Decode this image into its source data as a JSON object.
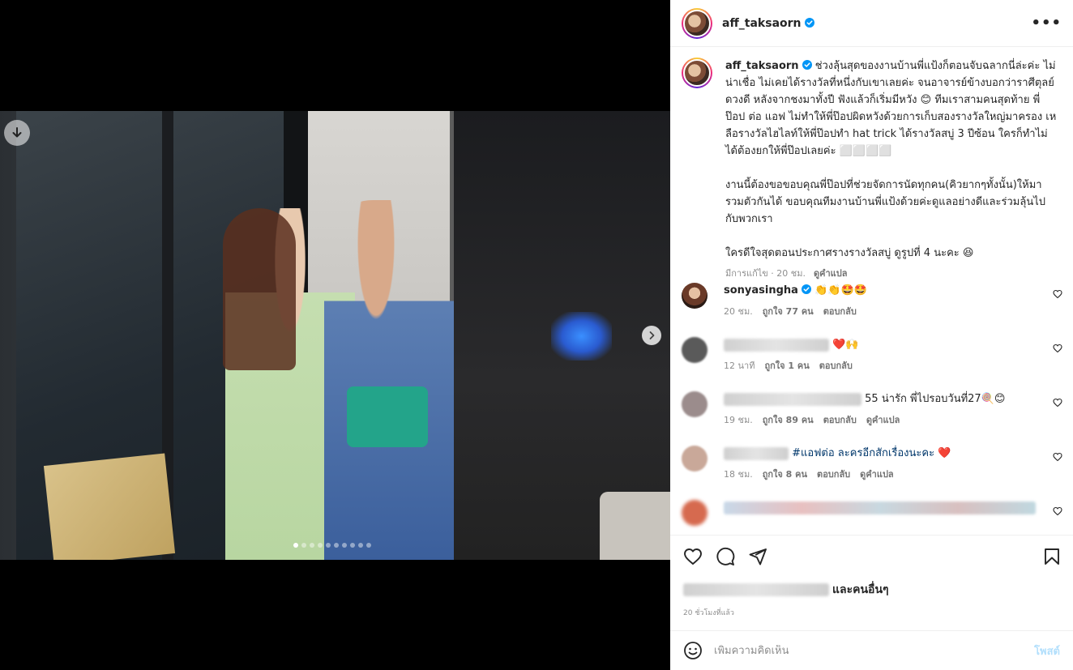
{
  "post": {
    "username": "aff_taksaorn",
    "more_label": "•••"
  },
  "media": {
    "dots_total": 10,
    "active_dot": 0
  },
  "caption": {
    "username": "aff_taksaorn",
    "paragraph1": "ช่วงลุ้นสุดของงานบ้านพี่แป้งก็ตอนจับฉลากนี่ล่ะค่ะ ไม่น่าเชื่อ ไม่เคยได้รางวัลที่หนึ่งกับเขาเลยค่ะ จนอาจารย์ข้างบอกว่าราศีตุลย์ดวงดี หลังจากชงมาทั้งปี ฟังแล้วก็เริ่มมีหวัง 😊 ทีมเราสามคนสุดท้าย พี่ป๊อป ต่อ แอฟ ไม่ทำให้พี่ป๊อปผิดหวังด้วยการเก็บสองรางวัลใหญ่มาครอง เหลือรางวัลไฮไลท์ให้พี่ป๊อปทำ hat trick ได้รางวัลสบู่ 3 ปีซ้อน ใครก็ทำไม่ได้ต้องยกให้พี่ป๊อปเลยค่ะ ⬜⬜⬜⬜",
    "paragraph2": "งานนี้ต้องขอขอบคุณพี่ป๊อปที่ช่วยจัดการนัดทุกคน(คิวยากๆทั้งนั้น)ให้มารวมตัวกันได้ ขอบคุณทีมงานบ้านพี่แป้งด้วยค่ะดูแลอย่างดีและร่วมลุ้นไปกับพวกเรา",
    "paragraph3": "ใครดีใจสุดตอนประกาศรางรางวัลสบู่ ดูรูปที่ 4 นะคะ 😆",
    "edited": "มีการแก้ไข · 20 ชม.",
    "translate": "ดูคำแปล"
  },
  "comments": [
    {
      "username": "sonyasingha",
      "text": "👏👏🤩🤩",
      "time": "20 ชม.",
      "likes": "ถูกใจ 77 คน",
      "reply": "ตอบกลับ",
      "translate": ""
    },
    {
      "username": "",
      "text": "❤️🙌",
      "time": "12 นาที",
      "likes": "ถูกใจ 1 คน",
      "reply": "ตอบกลับ",
      "translate": ""
    },
    {
      "username": "",
      "text": "55 น่ารัก พี่ไปรอบวันที่27🍭😊",
      "time": "19 ชม.",
      "likes": "ถูกใจ 89 คน",
      "reply": "ตอบกลับ",
      "translate": "ดูคำแปล"
    },
    {
      "username": "",
      "text": "#แอฟต่อ ละครอีกสักเรื่องนะคะ ❤️",
      "time": "18 ชม.",
      "likes": "ถูกใจ 8 คน",
      "reply": "ตอบกลับ",
      "translate": "ดูคำแปล"
    }
  ],
  "likes_line": {
    "suffix": "และคนอื่นๆ"
  },
  "ago": "20 ชั่วโมงที่แล้ว",
  "add_comment": {
    "placeholder": "เพิ่มความคิดเห็น",
    "post_label": "โพสต์"
  },
  "colors": {
    "verified": "#0095f6",
    "post_disabled": "#b2dffc",
    "heart_red": "#ed4956"
  }
}
